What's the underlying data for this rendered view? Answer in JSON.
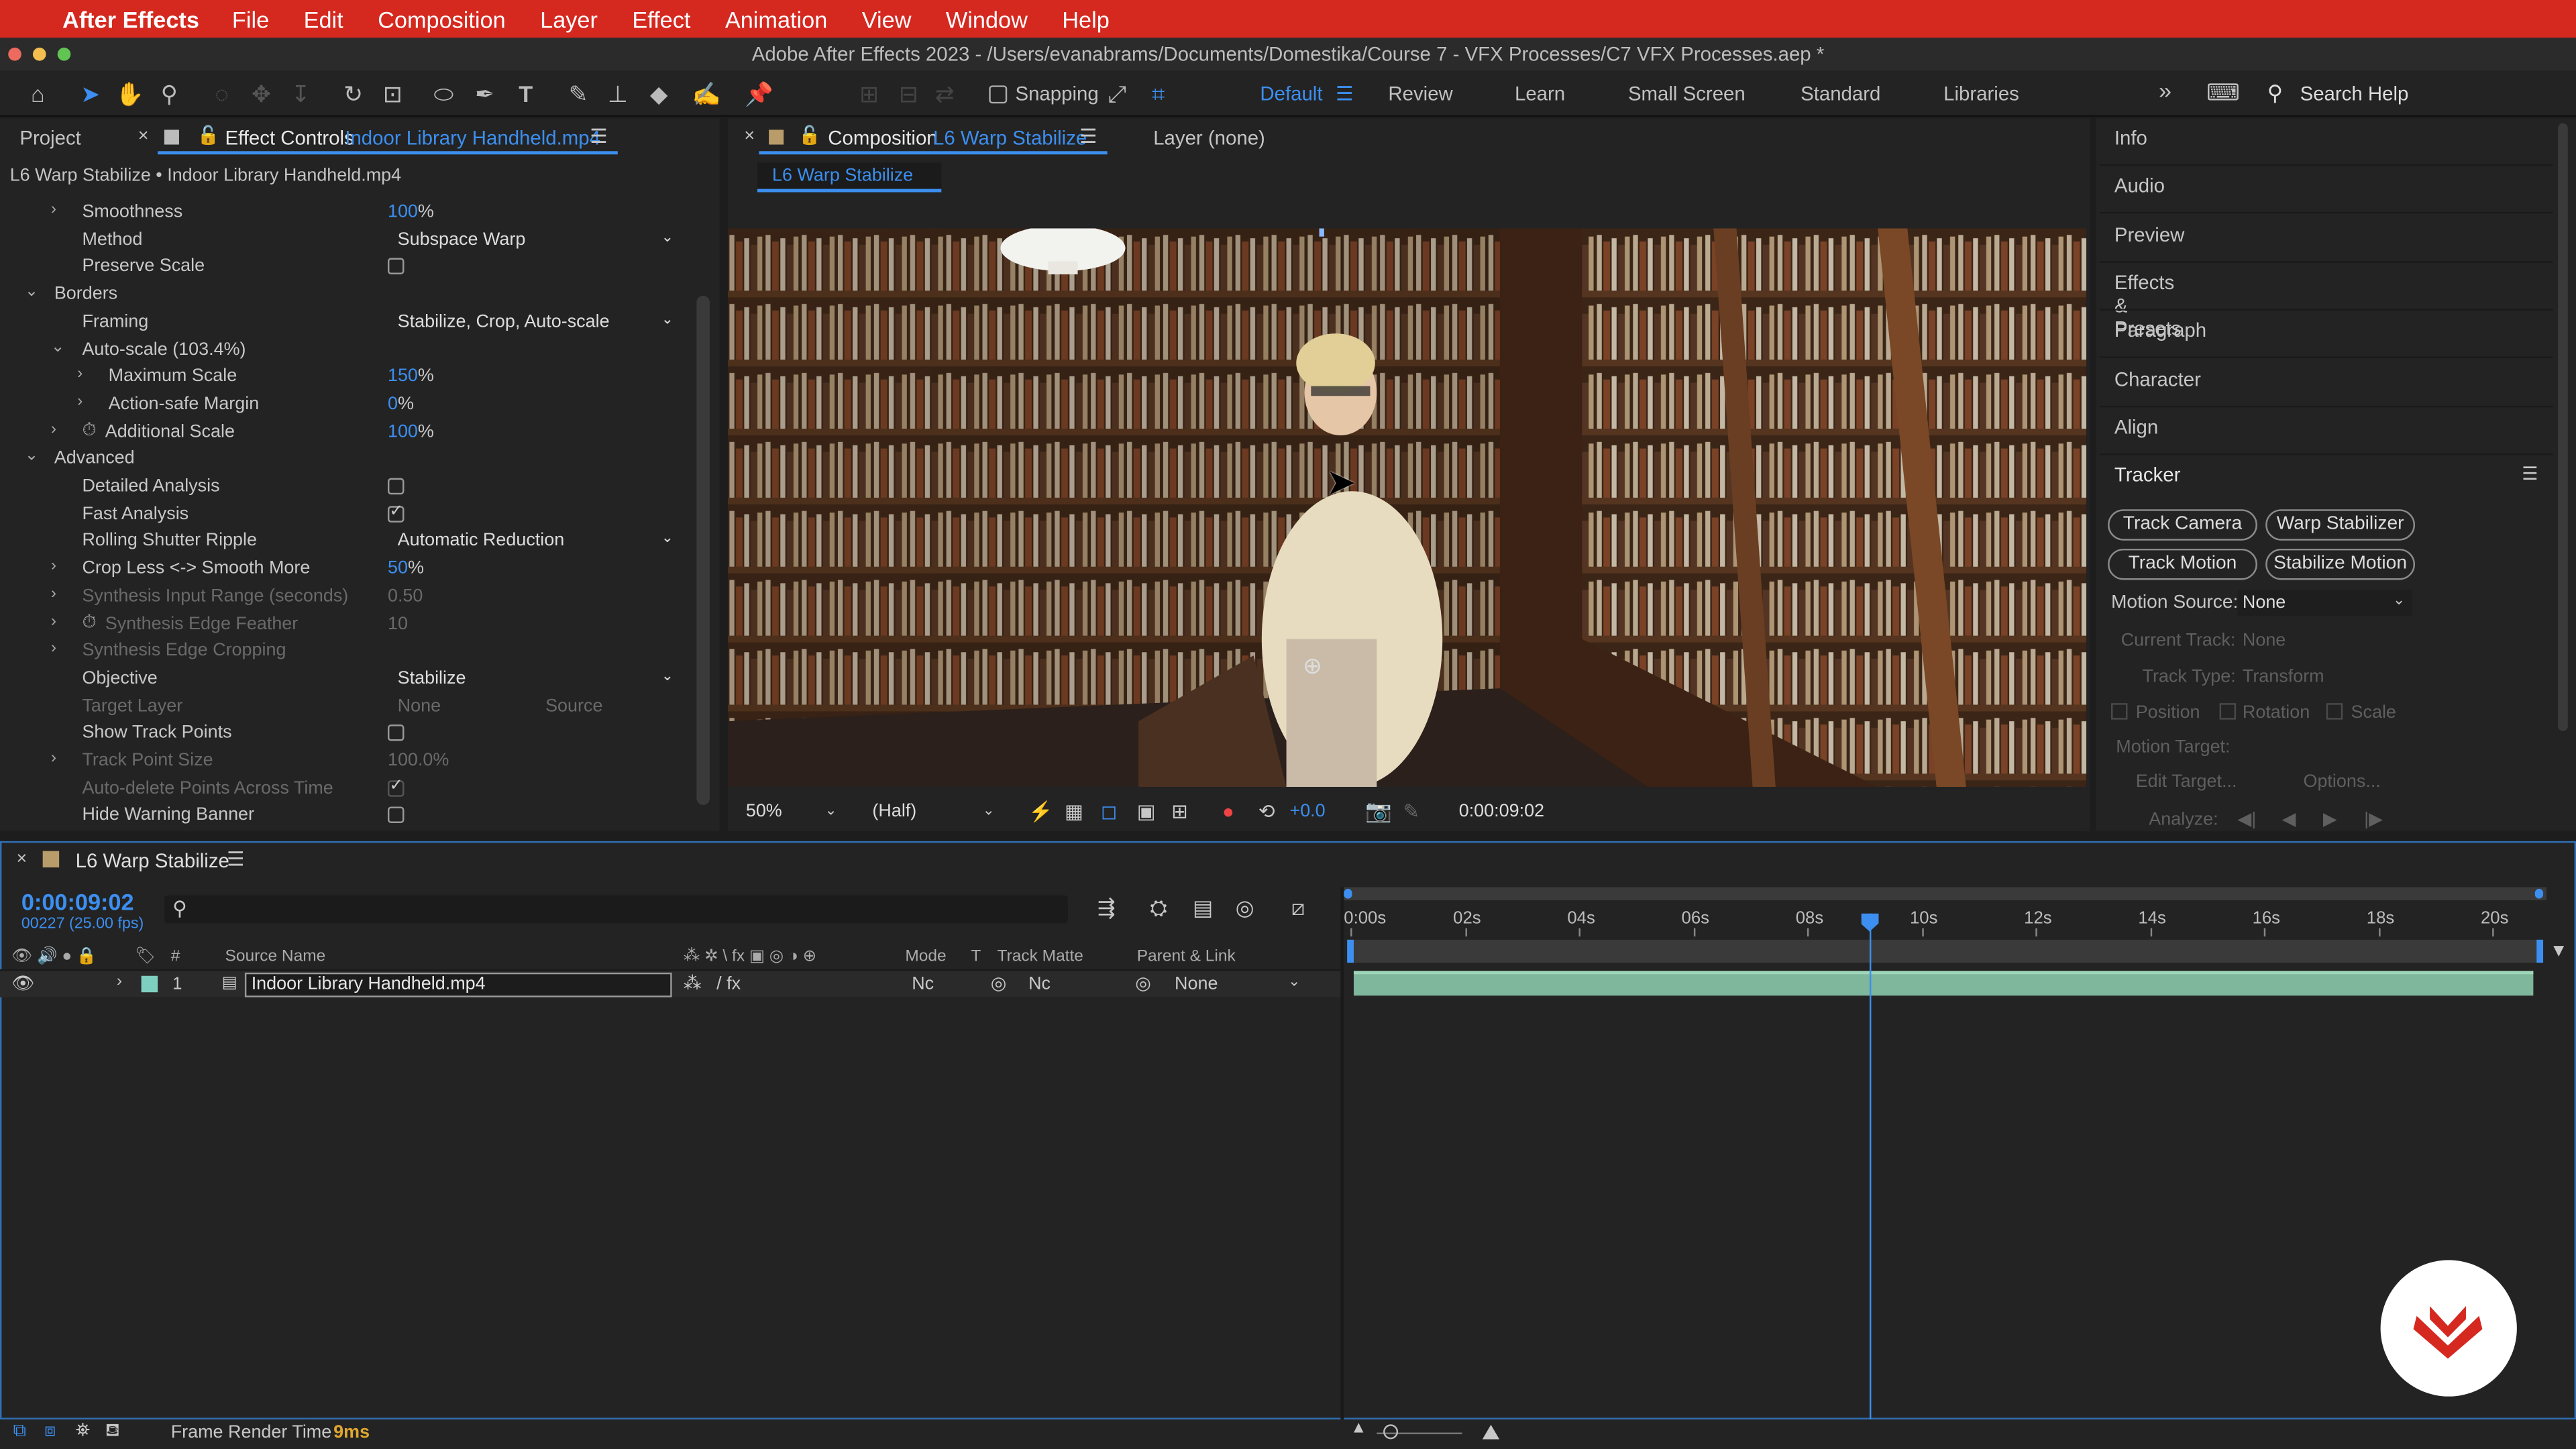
{
  "menubar": {
    "app": "After Effects",
    "items": [
      "File",
      "Edit",
      "Composition",
      "Layer",
      "Effect",
      "Animation",
      "View",
      "Window",
      "Help"
    ]
  },
  "titlebar": {
    "title": "Adobe After Effects 2023 - /Users/evanabrams/Documents/Domestika/Course 7 - VFX Processes/C7 VFX Processes.aep *"
  },
  "toolbar": {
    "snapping": "Snapping",
    "workspaces": [
      "Default",
      "Review",
      "Learn",
      "Small Screen",
      "Standard",
      "Libraries"
    ],
    "active_workspace": "Default",
    "search_placeholder": "Search Help"
  },
  "left_panel": {
    "tab_project": "Project",
    "tab_ec": "Effect Controls",
    "tab_ec_file": "Indoor Library Handheld.mp4",
    "breadcrumb": "L6 Warp Stabilize • Indoor Library Handheld.mp4",
    "rows": [
      {
        "label": "Smoothness",
        "indent": 1,
        "chev": "›",
        "value": "100",
        "unit": "%",
        "type": "num"
      },
      {
        "label": "Method",
        "indent": 1,
        "value": "Subspace Warp",
        "type": "dd"
      },
      {
        "label": "Preserve Scale",
        "indent": 1,
        "type": "cb",
        "checked": false
      },
      {
        "label": "Borders",
        "indent": 0,
        "chev": "⌄",
        "type": "group"
      },
      {
        "label": "Framing",
        "indent": 1,
        "value": "Stabilize, Crop, Auto-scale",
        "type": "dd"
      },
      {
        "label": "Auto-scale (103.4%)",
        "indent": 1,
        "chev": "⌄",
        "type": "group2"
      },
      {
        "label": "Maximum Scale",
        "indent": 2,
        "chev": "›",
        "value": "150",
        "unit": "%",
        "type": "num"
      },
      {
        "label": "Action-safe Margin",
        "indent": 2,
        "chev": "›",
        "value": "0",
        "unit": "%",
        "type": "num"
      },
      {
        "label": "Additional Scale",
        "indent": 1,
        "chev": "›",
        "stopwatch": true,
        "value": "100",
        "unit": "%",
        "type": "num"
      },
      {
        "label": "Advanced",
        "indent": 0,
        "chev": "⌄",
        "type": "group"
      },
      {
        "label": "Detailed Analysis",
        "indent": 1,
        "type": "cb",
        "checked": false
      },
      {
        "label": "Fast Analysis",
        "indent": 1,
        "type": "cb",
        "checked": true
      },
      {
        "label": "Rolling Shutter Ripple",
        "indent": 1,
        "value": "Automatic Reduction",
        "type": "dd"
      },
      {
        "label": "Crop Less <-> Smooth More",
        "indent": 1,
        "chev": "›",
        "value": "50",
        "unit": "%",
        "type": "num"
      },
      {
        "label": "Synthesis Input Range (seconds)",
        "indent": 1,
        "chev": "›",
        "value": "0.50",
        "type": "dimnum"
      },
      {
        "label": "Synthesis Edge Feather",
        "indent": 1,
        "chev": "›",
        "stopwatch": true,
        "value": "10",
        "type": "dimnum"
      },
      {
        "label": "Synthesis Edge Cropping",
        "indent": 1,
        "chev": "›",
        "type": "dimlabel"
      },
      {
        "label": "Objective",
        "indent": 1,
        "value": "Stabilize",
        "type": "dd"
      },
      {
        "label": "Target Layer",
        "indent": 1,
        "value": "None",
        "value2": "Source",
        "type": "dimdd"
      },
      {
        "label": "Show Track Points",
        "indent": 1,
        "type": "cb",
        "checked": false
      },
      {
        "label": "Track Point Size",
        "indent": 1,
        "chev": "›",
        "value": "100.0%",
        "type": "dimnum"
      },
      {
        "label": "Auto-delete Points Across Time",
        "indent": 1,
        "type": "dimcb",
        "checked": true
      },
      {
        "label": "Hide Warning Banner",
        "indent": 1,
        "type": "cb",
        "checked": false
      }
    ]
  },
  "comp": {
    "tab_label": "Composition",
    "tab_name": "L6 Warp Stabilize",
    "layer_tab": "Layer (none)",
    "sub_tab": "L6 Warp Stabilize",
    "zoom": "50%",
    "resolution": "(Half)",
    "exposure": "+0.0",
    "timecode": "0:00:09:02"
  },
  "right_panel": {
    "items": [
      "Info",
      "Audio",
      "Preview",
      "Effects & Presets",
      "Paragraph",
      "Character",
      "Align",
      "Tracker"
    ],
    "buttons": [
      "Track Camera",
      "Warp Stabilizer",
      "Track Motion",
      "Stabilize Motion"
    ],
    "motion_source_label": "Motion Source:",
    "motion_source_value": "None",
    "current_track_label": "Current Track:",
    "current_track_value": "None",
    "track_type_label": "Track Type:",
    "track_type_value": "Transform",
    "position": "Position",
    "rotation": "Rotation",
    "scale": "Scale",
    "motion_target": "Motion Target:",
    "edit_target": "Edit Target...",
    "options": "Options...",
    "analyze": "Analyze:"
  },
  "timeline": {
    "tab": "L6 Warp Stabilize",
    "timecode": "0:00:09:02",
    "frames": "00227 (25.00 fps)",
    "cols": {
      "num": "#",
      "source": "Source Name",
      "mode": "Mode",
      "t": "T",
      "trackmatte": "Track Matte",
      "parent": "Parent & Link"
    },
    "ticks": [
      "0:00s",
      "02s",
      "04s",
      "06s",
      "08s",
      "10s",
      "12s",
      "14s",
      "16s",
      "18s",
      "20s"
    ],
    "layer": {
      "index": "1",
      "name": "Indoor Library Handheld.mp4",
      "mode": "Nc",
      "matte": "Nc",
      "parent": "None"
    },
    "playhead_seconds": 9.08
  },
  "status": {
    "label": "Frame Render Time",
    "value": "9ms"
  },
  "colors": {
    "accent": "#3c8ff0",
    "menubar": "#d5281f",
    "clip": "#7fb79c",
    "logo": "#d5281f"
  }
}
